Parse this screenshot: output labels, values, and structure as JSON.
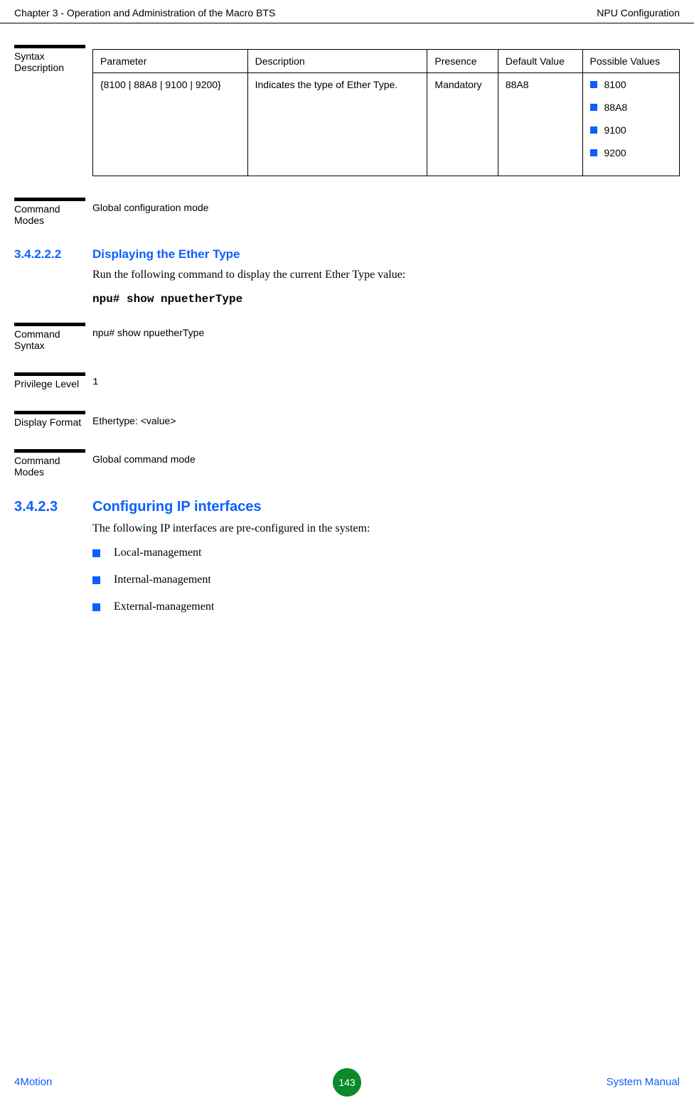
{
  "header": {
    "left": "Chapter 3 - Operation and Administration of the Macro BTS",
    "right": "NPU Configuration"
  },
  "syntax_description": {
    "label": "Syntax Description",
    "columns": [
      "Parameter",
      "Description",
      "Presence",
      "Default Value",
      "Possible Values"
    ],
    "rows": [
      {
        "parameter": "{8100 | 88A8 | 9100 | 9200}",
        "description": "Indicates the type of Ether Type.",
        "presence": "Mandatory",
        "default": "88A8",
        "possible": [
          "8100",
          "88A8",
          "9100",
          "9200"
        ]
      }
    ]
  },
  "command_modes_1": {
    "label": "Command Modes",
    "value": "Global configuration mode"
  },
  "section_34222": {
    "num": "3.4.2.2.2",
    "title": "Displaying the Ether Type",
    "body": "Run the following command to display the current Ether Type value:",
    "code": "npu# show npuetherType"
  },
  "command_syntax": {
    "label": "Command Syntax",
    "value": "npu# show npuetherType"
  },
  "privilege_level": {
    "label": "Privilege Level",
    "value": "1"
  },
  "display_format": {
    "label": "Display Format",
    "value": "Ethertype: <value>"
  },
  "command_modes_2": {
    "label": "Command Modes",
    "value": "Global command mode"
  },
  "section_3423": {
    "num": "3.4.2.3",
    "title": "Configuring IP interfaces",
    "body": "The following IP interfaces are pre-configured in the system:",
    "items": [
      "Local-management",
      "Internal-management",
      "External-management"
    ]
  },
  "footer": {
    "left": "4Motion",
    "page": "143",
    "right": "System Manual"
  }
}
